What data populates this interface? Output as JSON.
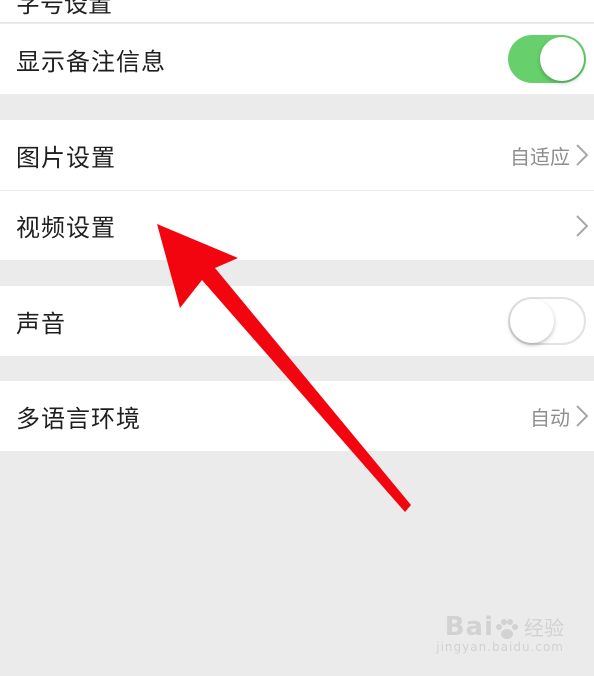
{
  "settings": {
    "top_cut_label": "字号设置",
    "group1": {
      "show_notes": {
        "label": "显示备注信息",
        "toggle": "on"
      }
    },
    "group2": {
      "image_settings": {
        "label": "图片设置",
        "value": "自适应"
      },
      "video_settings": {
        "label": "视频设置"
      }
    },
    "group3": {
      "sound": {
        "label": "声音",
        "toggle": "off"
      }
    },
    "group4": {
      "language": {
        "label": "多语言环境",
        "value": "自动"
      }
    }
  },
  "colors": {
    "toggle_on": "#67d06c",
    "background": "#ebebeb",
    "annotation_arrow": "#f2050e"
  },
  "icons": {
    "chevron": "chevron-right-icon",
    "arrow": "red-annotation-arrow-icon"
  },
  "watermark": {
    "brand": "Bai",
    "brand_cn": "经验",
    "url": "jingyan.baidu.com"
  }
}
